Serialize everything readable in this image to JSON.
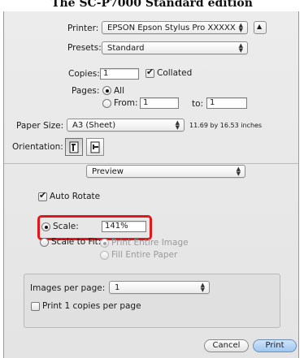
{
  "page_caption": "The SC-P7000 Standard edition",
  "printer": {
    "label": "Printer:",
    "value": "EPSON Epson Stylus Pro XXXXX"
  },
  "presets": {
    "label": "Presets:",
    "value": "Standard"
  },
  "copies": {
    "label": "Copies:",
    "value": "1",
    "collated_label": "Collated",
    "collated_checked": true
  },
  "pages": {
    "label": "Pages:",
    "all_label": "All",
    "from_label": "From:",
    "from_value": "1",
    "to_label": "to:",
    "to_value": "1",
    "selected": "All"
  },
  "paper_size": {
    "label": "Paper Size:",
    "value": "A3 (Sheet)",
    "dimensions": "11.69 by 16.53 inches"
  },
  "orientation": {
    "label": "Orientation:",
    "selected": "portrait"
  },
  "section_popup": {
    "value": "Preview"
  },
  "auto_rotate": {
    "label": "Auto Rotate",
    "checked": true
  },
  "scale": {
    "label": "Scale:",
    "value": "141%",
    "selected": true
  },
  "scale_to_fit": {
    "label": "Scale to Fit:",
    "print_entire_image": "Print Entire Image",
    "fill_entire_paper": "Fill Entire Paper"
  },
  "images_per_page": {
    "label": "Images per page:",
    "value": "1"
  },
  "print_copies": {
    "label": "Print 1 copies per page",
    "checked": false
  },
  "buttons": {
    "cancel": "Cancel",
    "print": "Print"
  },
  "colors": {
    "highlight": "#e0171b",
    "default_button": "#9fc6f0"
  }
}
